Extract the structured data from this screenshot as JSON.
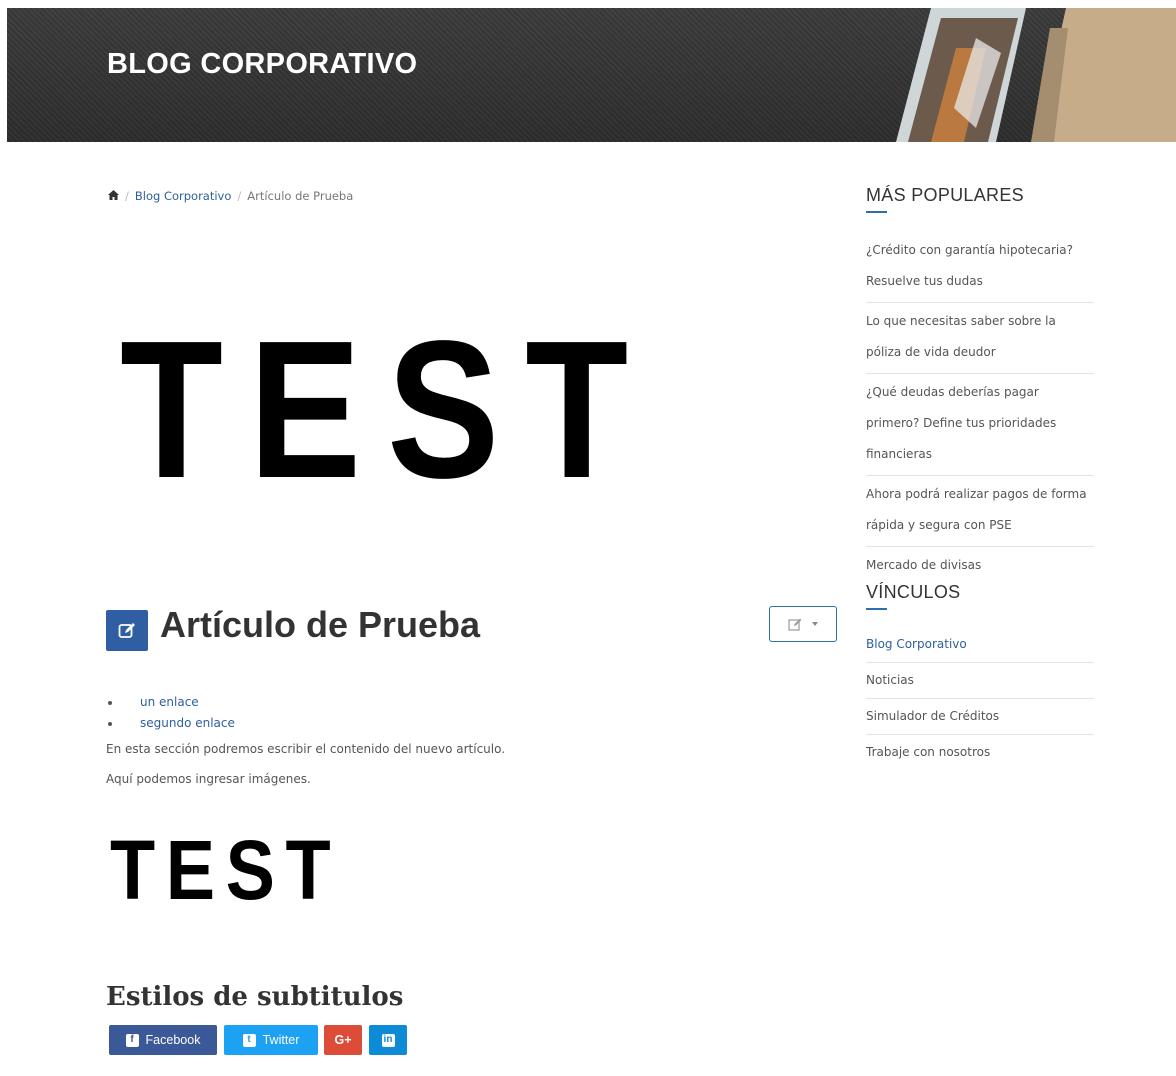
{
  "hero": {
    "title": "BLOG CORPORATIVO"
  },
  "breadcrumb": {
    "home_icon": "home-icon",
    "sep": "/",
    "section": "Blog Corporativo",
    "current": "Artículo de Prueba"
  },
  "main": {
    "hero_image_text": "TEST",
    "title": "Artículo de Prueba",
    "title_icon": "edit-icon",
    "edit_menu_icon": "edit-icon",
    "links": [
      "un enlace",
      "segundo enlace"
    ],
    "paragraphs": [
      "En esta sección podremos escribir el contenido del nuevo artículo.",
      "Aquí podemos ingresar imágenes."
    ],
    "inline_image_text": "TEST",
    "subtitle": "Estilos de subtitulos"
  },
  "share": {
    "facebook": "Facebook",
    "twitter": "Twitter",
    "googleplus": "G+",
    "linkedin": "in",
    "colors": {
      "facebook": "#3b5998",
      "twitter": "#1da1f2",
      "googleplus": "#dd4b39",
      "linkedin": "#0e8bd6"
    }
  },
  "sidebar": {
    "popular_heading": "MÁS POPULARES",
    "popular": [
      "¿Crédito con garantía hipotecaria? Resuelve tus dudas",
      "Lo que necesitas saber sobre la póliza de vida deudor",
      "¿Qué deudas deberías pagar primero? Define tus prioridades financieras",
      "Ahora podrá realizar pagos de forma rápida y segura con PSE",
      "Mercado de divisas"
    ],
    "links_heading": "VÍNCULOS",
    "links": [
      "Blog Corporativo",
      "Noticias",
      "Simulador de Créditos",
      "Trabaje con nosotros"
    ]
  },
  "colors": {
    "accent": "#2f5fa2",
    "link": "#2f5f9e",
    "hero_bg": "#333333"
  }
}
